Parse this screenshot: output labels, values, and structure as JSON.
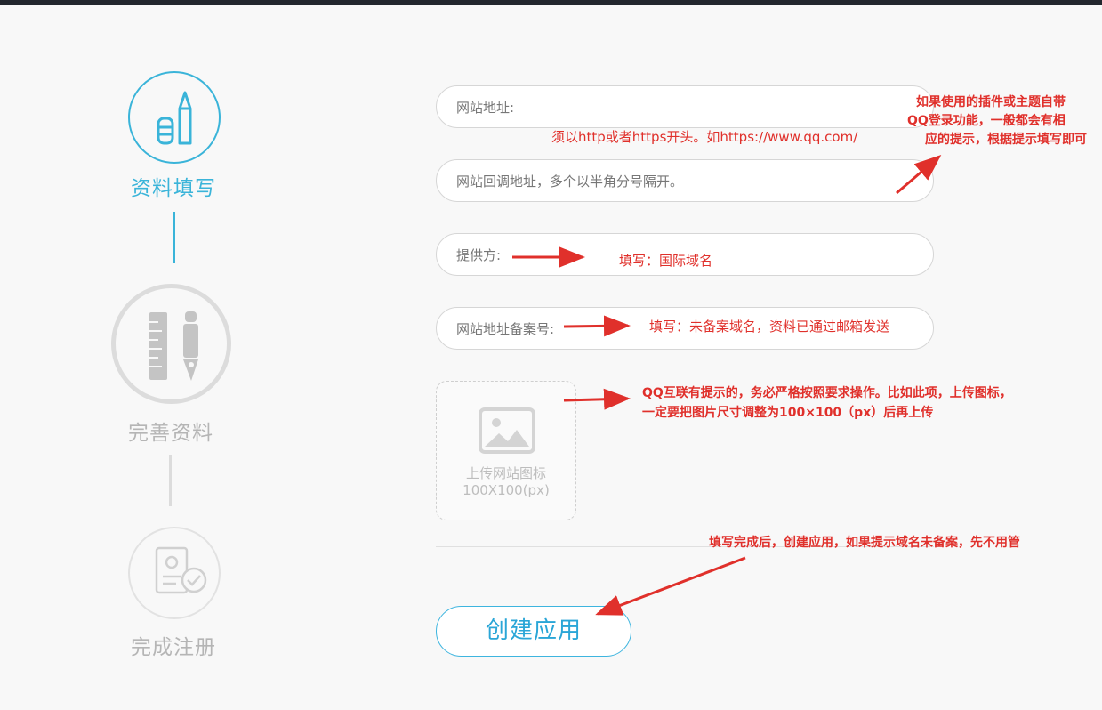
{
  "steps": [
    {
      "label": "资料填写",
      "state": "active",
      "color": "#3ab4d9",
      "icon": "pencil-eraser-icon"
    },
    {
      "label": "完善资料",
      "state": "pending",
      "color": "#b5b5b5",
      "icon": "ruler-pen-icon"
    },
    {
      "label": "完成注册",
      "state": "pending",
      "color": "#b5b5b5",
      "icon": "document-check-icon"
    }
  ],
  "form": {
    "website_url": {
      "placeholder": "网站地址:"
    },
    "website_url_hint": "须以http或者https开头。如https://www.qq.com/",
    "callback_url": {
      "placeholder": "网站回调地址，多个以半角分号隔开。"
    },
    "provider": {
      "placeholder": "提供方:"
    },
    "icp_number": {
      "placeholder": "网站地址备案号:"
    },
    "upload": {
      "line1": "上传网站图标",
      "line2": "100X100(px)"
    },
    "create_button": "创建应用"
  },
  "annotations": {
    "plugin_hint": [
      "如果使用的插件或主题自带",
      "QQ登录功能，一般都会有相",
      "应的提示，根据提示填写即可"
    ],
    "provider_hint": "填写：国际域名",
    "icp_hint": "填写：未备案域名，资料已通过邮箱发送",
    "upload_hint": [
      "QQ互联有提示的，务必严格按照要求操作。比如此项，上传图标，",
      "一定要把图片尺寸调整为100×100（px）后再上传"
    ],
    "create_hint": "填写完成后，创建应用，如果提示域名未备案，先不用管"
  },
  "colors": {
    "accent": "#3ab4d9",
    "annotation": "#e0302b",
    "inactive": "#b5b5b5"
  }
}
